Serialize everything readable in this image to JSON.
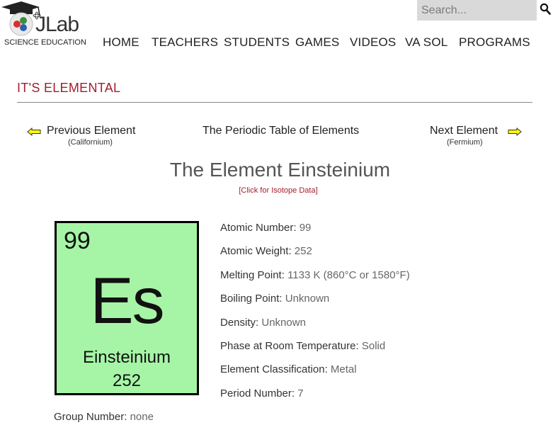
{
  "header": {
    "logo_text": "JLab",
    "logo_subtitle": "SCIENCE EDUCATION",
    "search_placeholder": "Search..."
  },
  "nav": {
    "items": [
      {
        "label": "HOME"
      },
      {
        "label": "TEACHERS"
      },
      {
        "label": "STUDENTS"
      },
      {
        "label": "GAMES"
      },
      {
        "label": "VIDEOS"
      },
      {
        "label": "VA SOL"
      },
      {
        "label": "PROGRAMS"
      }
    ]
  },
  "section": {
    "title": "IT'S ELEMENTAL"
  },
  "element_nav": {
    "previous_label": "Previous Element",
    "previous_name": "(Californium)",
    "periodic_table_label": "The Periodic Table of Elements",
    "next_label": "Next Element",
    "next_name": "(Fermium)"
  },
  "element": {
    "title": "The Element Einsteinium",
    "isotope_link": "[Click for Isotope Data]",
    "tile": {
      "atomic_number": "99",
      "symbol": "Es",
      "name": "Einsteinium",
      "mass": "252",
      "color": "#a6f5a6"
    },
    "properties": [
      {
        "key": "Atomic Number",
        "value": "99"
      },
      {
        "key": "Atomic Weight",
        "value": "252"
      },
      {
        "key": "Melting Point",
        "value": "1133 K (860°C or 1580°F)"
      },
      {
        "key": "Boiling Point",
        "value": "Unknown"
      },
      {
        "key": "Density",
        "value": "Unknown"
      },
      {
        "key": "Phase at Room Temperature",
        "value": "Solid"
      },
      {
        "key": "Element Classification",
        "value": "Metal"
      },
      {
        "key": "Period Number",
        "value": "7"
      }
    ],
    "group": {
      "key": "Group Number",
      "value": "none"
    }
  },
  "colors": {
    "accent": "#a31d2d",
    "arrow_fill": "#ffff00"
  },
  "icons": {
    "search": "search-icon",
    "prev": "arrow-left-icon",
    "next": "arrow-right-icon",
    "logo": "graduation-cap-atom-icon"
  }
}
